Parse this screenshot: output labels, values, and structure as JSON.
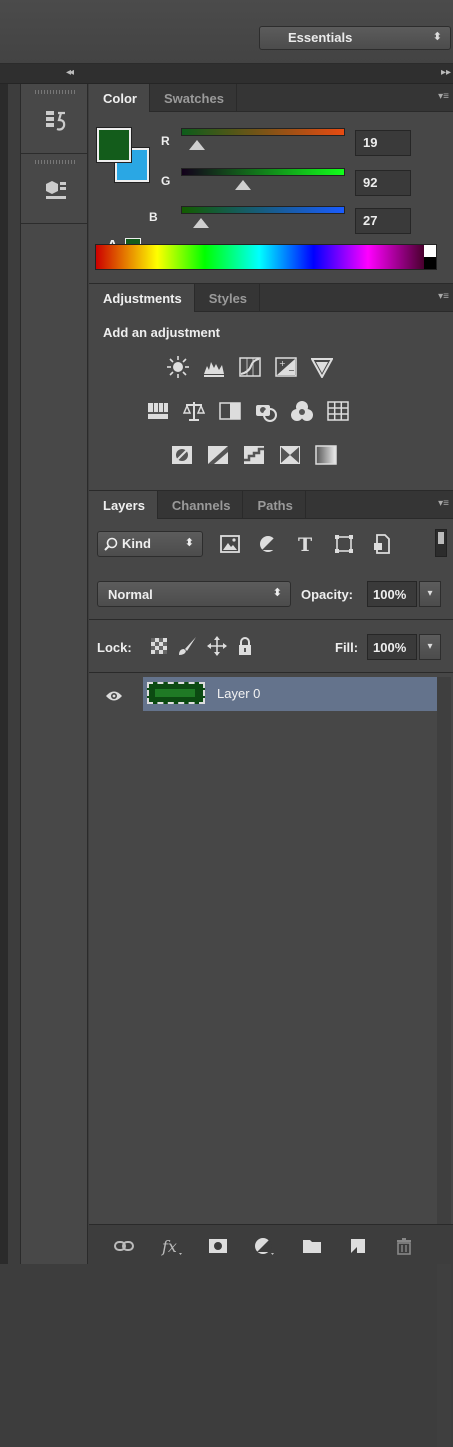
{
  "workspace": {
    "label": "Essentials",
    "arrows": "⬍"
  },
  "dock": {
    "collapse_left": "◂◂",
    "collapse_right": "▸▸"
  },
  "color_panel": {
    "tabs": [
      {
        "label": "Color"
      },
      {
        "label": "Swatches"
      }
    ],
    "menu": "▾≡",
    "foreground": "#135c1b",
    "background": "#2aa7e4",
    "channels": [
      {
        "label": "R",
        "value": "19"
      },
      {
        "label": "G",
        "value": "92"
      },
      {
        "label": "B",
        "value": "27"
      }
    ],
    "warn": "A"
  },
  "adjustments_panel": {
    "tabs": [
      {
        "label": "Adjustments"
      },
      {
        "label": "Styles"
      }
    ],
    "menu": "▾≡",
    "title": "Add an adjustment"
  },
  "layers_panel": {
    "tabs": [
      {
        "label": "Layers"
      },
      {
        "label": "Channels"
      },
      {
        "label": "Paths"
      }
    ],
    "menu": "▾≡",
    "filter_kind": "Kind",
    "blend_mode": "Normal",
    "opacity_label": "Opacity:",
    "opacity_value": "100%",
    "lock_label": "Lock:",
    "fill_label": "Fill:",
    "fill_value": "100%",
    "select_arrows": "⬍",
    "drop_arrow": "▾",
    "layers": [
      {
        "name": "Layer 0"
      }
    ]
  }
}
